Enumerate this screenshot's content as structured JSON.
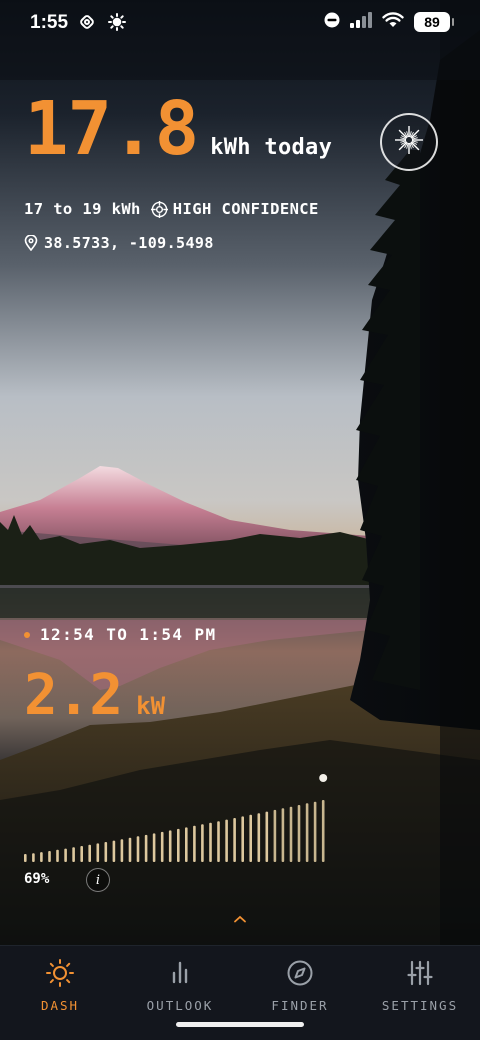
{
  "status_bar": {
    "time": "1:55",
    "battery": "89",
    "icons": [
      "location-tracker-icon",
      "brightness-icon",
      "do-not-disturb-icon",
      "signal-icon",
      "wifi-icon",
      "battery-icon"
    ]
  },
  "hero": {
    "energy_value": "17.8",
    "energy_unit": "kWh today",
    "range": "17 to 19 kWh",
    "confidence": "HIGH CONFIDENCE",
    "coordinates": "38.5733, -109.5498",
    "compass_icon": "compass-rose-icon"
  },
  "window": {
    "label": "12:54 TO 1:54 PM",
    "power_value": "2.2",
    "power_unit": "kW",
    "percent_label": "69%",
    "info_label": "i",
    "progress": 0.69
  },
  "colors": {
    "accent": "#f29133",
    "bar": "#e8d2a6",
    "tab_bar": "#13161d",
    "inactive_tab": "#9aa0a8"
  },
  "tabs": [
    {
      "label": "DASH",
      "icon": "sun-icon",
      "active": true
    },
    {
      "label": "OUTLOOK",
      "icon": "bar-chart-icon",
      "active": false
    },
    {
      "label": "FINDER",
      "icon": "compass-icon",
      "active": false
    },
    {
      "label": "SETTINGS",
      "icon": "sliders-icon",
      "active": false
    }
  ]
}
